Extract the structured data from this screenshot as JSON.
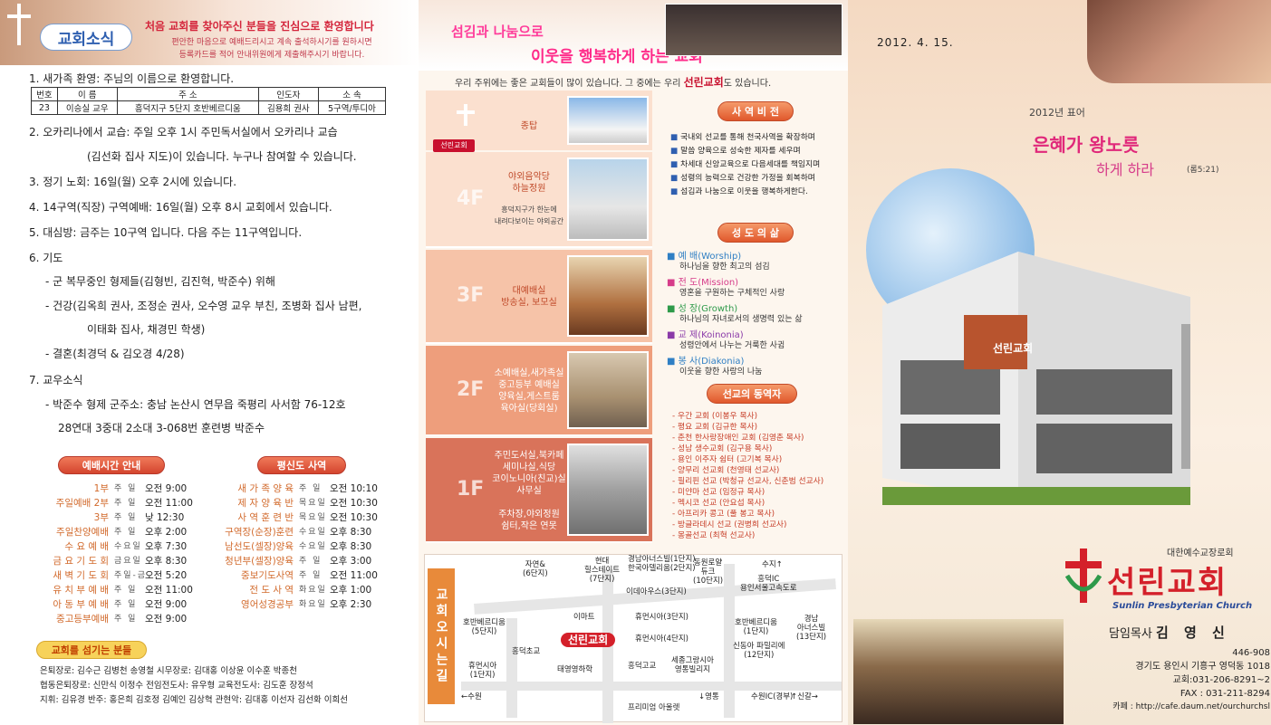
{
  "panel1": {
    "header_tab": "교회소식",
    "welcome_title": "처음 교회를 찾아주신 분들을 진심으로 환영합니다",
    "welcome_sub1": "편안한 마음으로 예배드리시고 계속 출석하시기를 원하시면",
    "welcome_sub2": "등록카드를 적어 안내위원에게 제출해주시기 바랍니다.",
    "item1": "1. 새가족 환영: 주님의 이름으로 환영합니다.",
    "visitor_headers": [
      "번호",
      "이  름",
      "주  소",
      "인도자",
      "소  속"
    ],
    "visitor_row": [
      "23",
      "이승실 교우",
      "흥덕지구 5단지 호반베르디움",
      "김용희 권사",
      "5구역/투디아"
    ],
    "item2a": "2. 오카리나에서 교습: 주일 오후 1시 주민독서실에서 오카리나 교습",
    "item2b": "(김선화 집사 지도)이 있습니다. 누구나 참여할 수 있습니다.",
    "item3": "3. 정기 노회: 16일(월) 오후 2시에 있습니다.",
    "item4": "4. 14구역(직장) 구역예배: 16일(월) 오후 8시 교회에서 있습니다.",
    "item5": "5. 대심방: 금주는 10구역 입니다. 다음 주는 11구역입니다.",
    "item6": "6. 기도",
    "item6a": "- 군 복무중인 형제들(김형빈, 김진혁, 박준수) 위해",
    "item6b": "- 건강(김옥희 권사, 조정순 권사, 오수영 교우 부친, 조병화 집사 남편,",
    "item6b2": "이태화 집사, 채경민 학생)",
    "item6c": "- 결혼(최경덕 & 김오경 4/28)",
    "item7": "7. 교우소식",
    "item7a": "- 박준수 형제 군주소: 충남 논산시 연무읍 죽평리 사서함 76-12호",
    "item7b": "28연대  3중대 2소대 3-068번 훈련병 박준수",
    "worship_title": "예배시간 안내",
    "worship": [
      {
        "name": "1부",
        "day": "주 일",
        "time": "오전 9:00"
      },
      {
        "name": "주일예배 2부",
        "day": "주 일",
        "time": "오전 11:00"
      },
      {
        "name": "3부",
        "day": "주 일",
        "time": "낮 12:30"
      },
      {
        "name": "주일찬양예배",
        "day": "주 일",
        "time": "오후 2:00"
      },
      {
        "name": "수 요 예 배",
        "day": "수요일",
        "time": "오후 7:30"
      },
      {
        "name": "금 요 기 도 회",
        "day": "금요일",
        "time": "오후 8:30"
      },
      {
        "name": "새 벽 기 도 회",
        "day": "주일-금",
        "time": "오전 5:20"
      },
      {
        "name": "유 치 부 예 배",
        "day": "주 일",
        "time": "오전 11:00"
      },
      {
        "name": "아 동 부 예 배",
        "day": "주 일",
        "time": "오전 9:00"
      },
      {
        "name": "중고등부예배",
        "day": "주 일",
        "time": "오전 9:00"
      }
    ],
    "lay_title": "평신도 사역",
    "lay": [
      {
        "name": "새 가 족 양 육",
        "day": "주 일",
        "time": "오전 10:10"
      },
      {
        "name": "제 자 양 육 반",
        "day": "목요일",
        "time": "오전 10:30"
      },
      {
        "name": "사 역 훈 련 반",
        "day": "목요일",
        "time": "오전 10:30"
      },
      {
        "name": "구역장(순장)훈련",
        "day": "수요일",
        "time": "오후 8:30"
      },
      {
        "name": "남선도(셀장)양육",
        "day": "수요일",
        "time": "오후 8:30"
      },
      {
        "name": "청년부(셀장)양육",
        "day": "주 일",
        "time": "오후 3:00"
      },
      {
        "name": "중보기도사역",
        "day": "주 일",
        "time": "오전 11:00"
      },
      {
        "name": "전 도 사 역",
        "day": "화요일",
        "time": "오후 1:00"
      },
      {
        "name": "영어성경공부",
        "day": "화요일",
        "time": "오후 2:30"
      }
    ],
    "helpers_title": "교회를 섬기는 분들",
    "helpers_line1": "은퇴장로: 김수근 김병천 송영철      시무장로: 김대홍 이상윤 이수훈 박종천",
    "helpers_line2": "협동은퇴장로: 신만식 이정수    전임전도사: 유우형    교육전도사: 김도훈 장정석",
    "helpers_line3": "지휘: 김유경   반주: 홍은희 김호정 김예인 김상혁  관현악: 김대홍 이선자 김선화 이희선"
  },
  "panel2": {
    "title1": "섬김과 나눔으로",
    "title2": "이웃을 행복하게 하는 교회",
    "intro_pre": "우리 주위에는 좋은 교회들이 많이 있습니다. 그 중에는 우리 ",
    "intro_name": "선린교회",
    "intro_post": "도 있습니다.",
    "bell_label": "종탑",
    "sign_label": "선린교회",
    "floors": [
      {
        "label": "4F",
        "text": "야외음악당\n하늘정원",
        "note": "흥덕지구가 한눈에\n내려다보이는 야외공간"
      },
      {
        "label": "3F",
        "text": "대예배실\n방송실, 보모실",
        "note": ""
      },
      {
        "label": "2F",
        "text": "소예배실,새가족실\n중고등부 예배실\n양육실,게스트룸\n육아실(당회실)",
        "note": ""
      },
      {
        "label": "1F",
        "text": "주민도서실,북카페\n세미나실,식당\n코이노니아(친교)실\n사무실\n\n주차장,야외정원\n쉼터,작은 연못",
        "note": ""
      }
    ],
    "vision_title": "사 역 비 전",
    "vision": [
      "국내외 선교를 통해 천국사역을 확장하며",
      "말씀 양육으로 성숙한 제자를 세우며",
      "차세대 신앙교육으로 다음세대를 책임지며",
      "성령의 능력으로 건강한 가정을 회복하며",
      "섬김과 나눔으로 이웃을 행복하게한다."
    ],
    "life_title": "성 도 의 삶",
    "life": [
      {
        "head": "예 배(Worship)",
        "desc": "하나님을 향한 최고의 섬김",
        "color": "#2f7fc4"
      },
      {
        "head": "전 도(Mission)",
        "desc": "영혼을 구원하는 구체적인 사랑",
        "color": "#d63c8a"
      },
      {
        "head": "성 장(Growth)",
        "desc": "하나님의 자녀로서의 생명력 있는 삶",
        "color": "#2e9a4a"
      },
      {
        "head": "교 제(Koinonia)",
        "desc": "성령안에서 나누는 거룩한 사귐",
        "color": "#8a3aa8"
      },
      {
        "head": "봉 사(Diakonia)",
        "desc": "이웃을 향한 사랑의 나눔",
        "color": "#2f7fc4"
      }
    ],
    "mission_title": "선교의 동역자",
    "missions": [
      "- 우간 교회 (이봉우 목사)",
      "- 평요 교회 (김규한 목사)",
      "- 춘천 한사랑장애인 교회 (김영춘 목사)",
      "- 성남  생수교회 (김구용 목사)",
      "- 용인 이주자 쉼터 (고기복 목사)",
      "- 양무리 선교회 (천영태 선교사)",
      "- 필리핀 선교 (박청규 선교사, 신춘범 선교사)",
      "- 미얀마 선교 (임정규 목사)",
      "- 멕시코 선교 (안요섭 목사)",
      "- 아프리카 콩고 (풀 봉고 목사)",
      "- 방글라데시 선교 (권병희 선교사)",
      "- 몽골선교 (최혁 선교사)"
    ],
    "map_vertical": "교회오시는길",
    "map_labels": [
      "자연&\n(6단지)",
      "현대\n힐스테이트\n(7단지)",
      "경남아너스빌(1단지)\n한국아델리움(2단지)",
      "동원로얄\n듀크\n(10단지)",
      "수지↑",
      "흥덕IC\n용인서울고속도로",
      "이데아우스(3단지)",
      "이마트",
      "휴먼시아(3단지)",
      "호반베르디움\n(5단지)",
      "휴먼시아(4단지)",
      "흥덕초교",
      "선린교회",
      "휴먼시아\n(1단지)",
      "태영영하학",
      "흥덕고교",
      "세종그랑시아\n영통빌리지",
      "호반베르디움\n(1단지)",
      "신동아 파밀리에\n(12단지)",
      "경남\n아너스빌\n(13단지)",
      "←수원",
      "↓영통",
      "수원IC(경부)",
      "↑신갈→",
      "프리미엄 아울렛"
    ]
  },
  "panel3": {
    "date": "2012.  4.  15.",
    "year_motto": "2012년 표어",
    "verse1": "은혜가 왕노릇",
    "verse2": "하게 하라",
    "verse_ref": "(롬5:21)",
    "sign_on_building": "선린교회",
    "denomination": "대한예수교장로회",
    "church_name": "선린교회",
    "church_en": "Sunlin Presbyterian Church",
    "pastor_label": "담임목사",
    "pastor_name": "김 영 신",
    "postcode": "446-908",
    "address": "경기도 용인시 기흥구 영덕동 1018",
    "tel": "교회:031-206-8291~2",
    "fax": "FAX : 031-211-8294",
    "cafe": "카페 : http://cafe.daum.net/ourchurchsl"
  },
  "colors": {
    "accent_red": "#d4202a",
    "accent_pink": "#e0287a",
    "orange": "#e0582c",
    "blue": "#2e5fb0"
  }
}
